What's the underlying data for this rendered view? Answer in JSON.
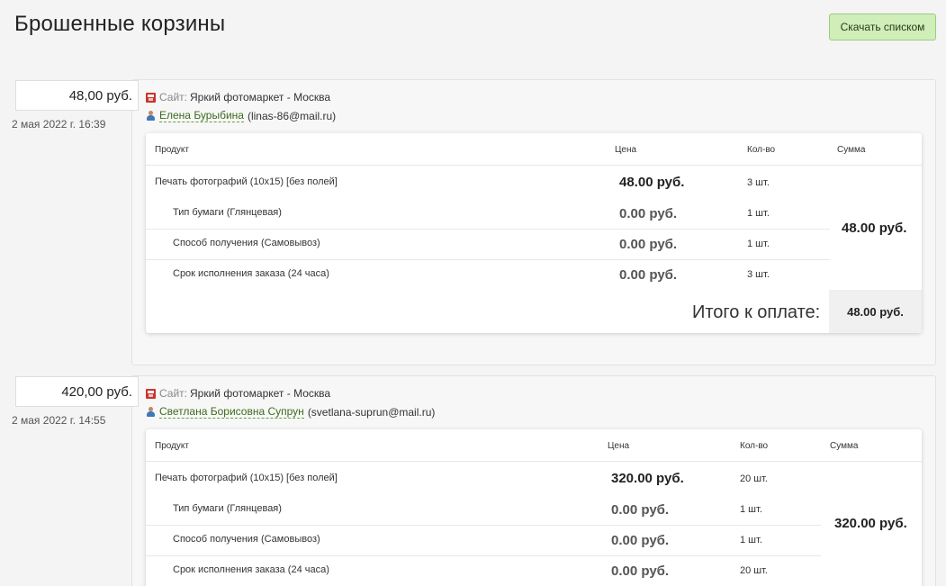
{
  "header": {
    "title": "Брошенные корзины",
    "download_label": "Скачать списком"
  },
  "colors": {
    "accent_button": "#cfeeb8",
    "link": "#3d6b1e",
    "site_icon": "#c9342a"
  },
  "columns": {
    "product": "Продукт",
    "price": "Цена",
    "qty": "Кол-во",
    "sum": "Сумма"
  },
  "carts": [
    {
      "amount": "48,00 руб.",
      "date": "2 мая 2022 г. 16:39",
      "site_label": "Сайт:",
      "site_name": "Яркий фотомаркет - Москва",
      "user_name": "Елена Бурыбина",
      "user_email": "(linas-86@mail.ru)",
      "items": [
        {
          "name": "Печать фотографий (10x15) [без полей]",
          "price": "48.00 руб.",
          "qty": "3 шт."
        },
        {
          "name": "Тип бумаги (Глянцевая)",
          "price": "0.00 руб.",
          "qty": "1 шт."
        },
        {
          "name": "Способ получения (Самовывоз)",
          "price": "0.00 руб.",
          "qty": "1 шт."
        },
        {
          "name": "Срок исполнения заказа (24 часа)",
          "price": "0.00 руб.",
          "qty": "3 шт."
        }
      ],
      "sum": "48.00 руб.",
      "total_label": "Итого к оплате:",
      "total": "48.00 руб."
    },
    {
      "amount": "420,00 руб.",
      "date": "2 мая 2022 г. 14:55",
      "site_label": "Сайт:",
      "site_name": "Яркий фотомаркет - Москва",
      "user_name": "Светлана Борисовна Супрун",
      "user_email": "(svetlana-suprun@mail.ru)",
      "items": [
        {
          "name": "Печать фотографий (10x15) [без полей]",
          "price": "320.00 руб.",
          "qty": "20 шт."
        },
        {
          "name": "Тип бумаги (Глянцевая)",
          "price": "0.00 руб.",
          "qty": "1 шт."
        },
        {
          "name": "Способ получения (Самовывоз)",
          "price": "0.00 руб.",
          "qty": "1 шт."
        },
        {
          "name": "Срок исполнения заказа (24 часа)",
          "price": "0.00 руб.",
          "qty": "20 шт."
        }
      ],
      "sum": "320.00 руб."
    }
  ]
}
